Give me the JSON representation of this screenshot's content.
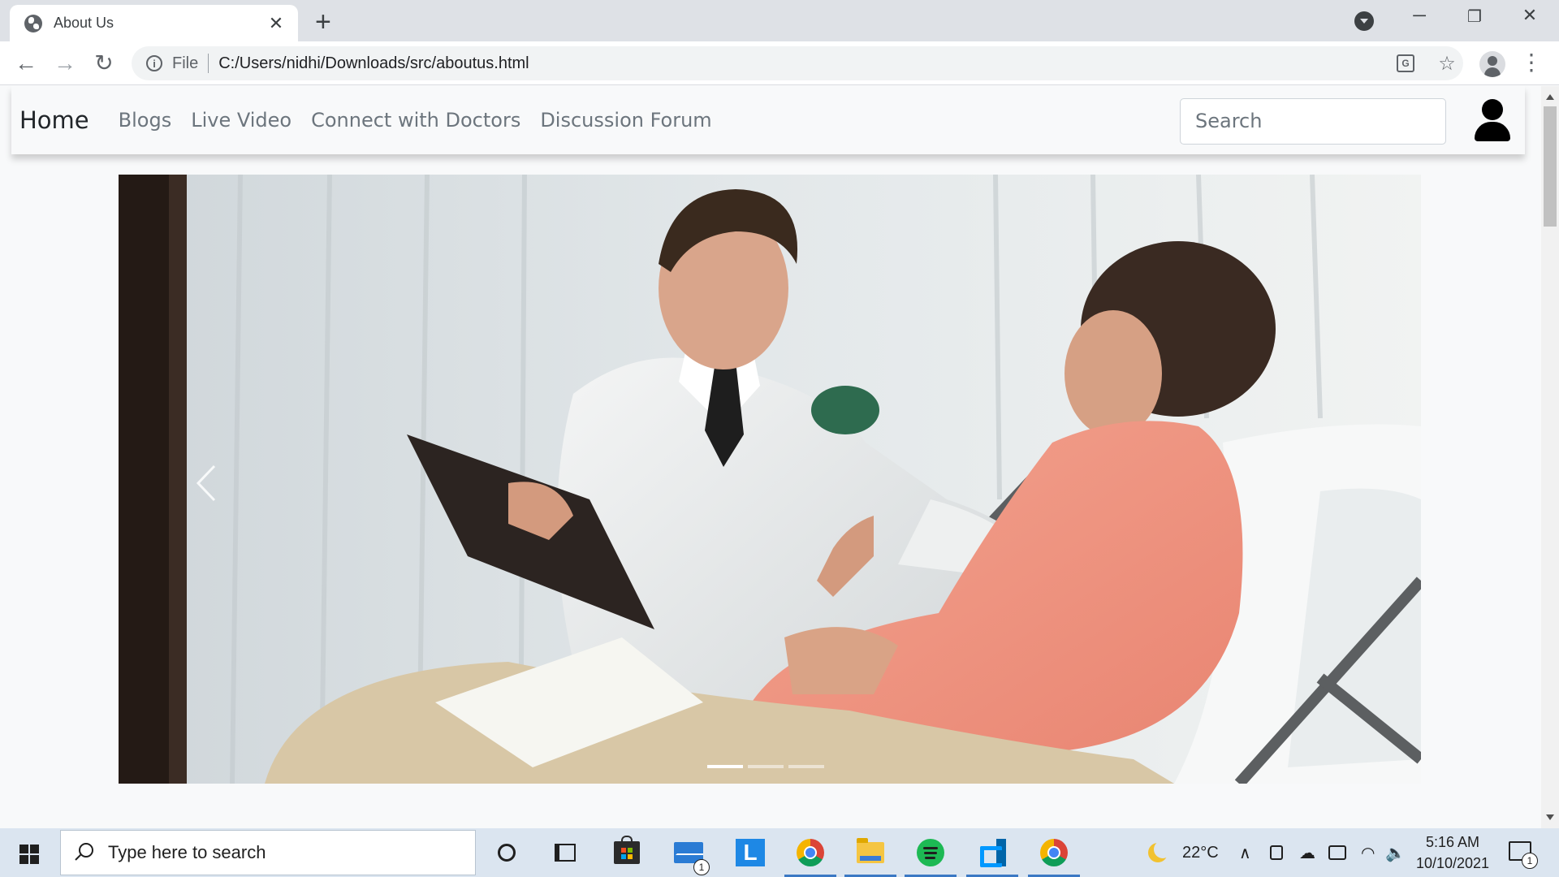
{
  "browser": {
    "tab_title": "About Us",
    "address_scheme": "File",
    "url": "C:/Users/nidhi/Downloads/src/aboutus.html"
  },
  "site": {
    "brand": "Home",
    "nav": [
      {
        "label": "Blogs"
      },
      {
        "label": "Live Video"
      },
      {
        "label": "Connect with Doctors"
      },
      {
        "label": "Discussion Forum"
      }
    ],
    "search_placeholder": "Search"
  },
  "carousel": {
    "slide_count": 3,
    "active_index": 0
  },
  "taskbar": {
    "search_placeholder": "Type here to search",
    "mail_badge": "1",
    "weather": "22°C",
    "time": "5:16 AM",
    "date": "10/10/2021",
    "notification_badge": "1"
  }
}
